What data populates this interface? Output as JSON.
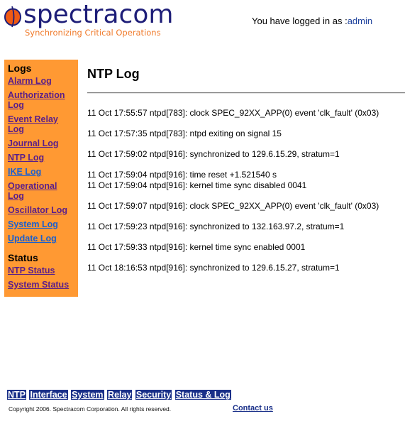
{
  "header": {
    "logo_text": "spectracom",
    "logo_tagline": "Synchronizing Critical Operations",
    "login_prefix": "You have logged in as :",
    "login_user": "admin"
  },
  "sidebar": {
    "logs_heading": "Logs",
    "log_items": [
      {
        "label": "Alarm Log",
        "visited": true
      },
      {
        "label": "Authorization Log",
        "visited": true
      },
      {
        "label": "Event Relay Log",
        "visited": true
      },
      {
        "label": "Journal Log",
        "visited": true
      },
      {
        "label": "NTP Log",
        "visited": true
      },
      {
        "label": "IKE Log",
        "visited": false
      },
      {
        "label": "Operational Log",
        "visited": true
      },
      {
        "label": "Oscillator Log",
        "visited": true
      },
      {
        "label": "System Log",
        "visited": false
      },
      {
        "label": "Update Log",
        "visited": false
      }
    ],
    "status_heading": "Status",
    "status_items": [
      {
        "label": "NTP Status",
        "visited": true
      },
      {
        "label": "System Status",
        "visited": true
      }
    ]
  },
  "main": {
    "title": "NTP Log",
    "entries": [
      [
        "11 Oct 17:55:57 ntpd[783]: clock SPEC_92XX_APP(0) event 'clk_fault' (0x03)"
      ],
      [
        "11 Oct 17:57:35 ntpd[783]: ntpd exiting on signal 15"
      ],
      [
        "11 Oct 17:59:02 ntpd[916]: synchronized to 129.6.15.29, stratum=1"
      ],
      [
        "11 Oct 17:59:04 ntpd[916]: time reset +1.521540 s",
        "11 Oct 17:59:04 ntpd[916]: kernel time sync disabled 0041"
      ],
      [
        "11 Oct 17:59:07 ntpd[916]: clock SPEC_92XX_APP(0) event 'clk_fault' (0x03)"
      ],
      [
        "11 Oct 17:59:23 ntpd[916]: synchronized to 132.163.97.2, stratum=1"
      ],
      [
        "11 Oct 17:59:33 ntpd[916]: kernel time sync enabled 0001"
      ],
      [
        "11 Oct 18:16:53 ntpd[916]: synchronized to 129.6.15.27, stratum=1"
      ]
    ]
  },
  "footer": {
    "nav": [
      "NTP",
      "Interface",
      "System",
      "Relay",
      "Security",
      "Status & Log"
    ],
    "copyright": "Copyright 2006. Spectracom Corporation. All rights reserved.",
    "contact": "Contact us"
  },
  "colors": {
    "sidebar_bg": "#ff9933",
    "brand_navy": "#1e1e78",
    "brand_orange": "#f07a2a",
    "visited_link": "#5a1e8a",
    "unvisited_link": "#1a5fd0",
    "footer_nav_bg": "#1a3089"
  }
}
